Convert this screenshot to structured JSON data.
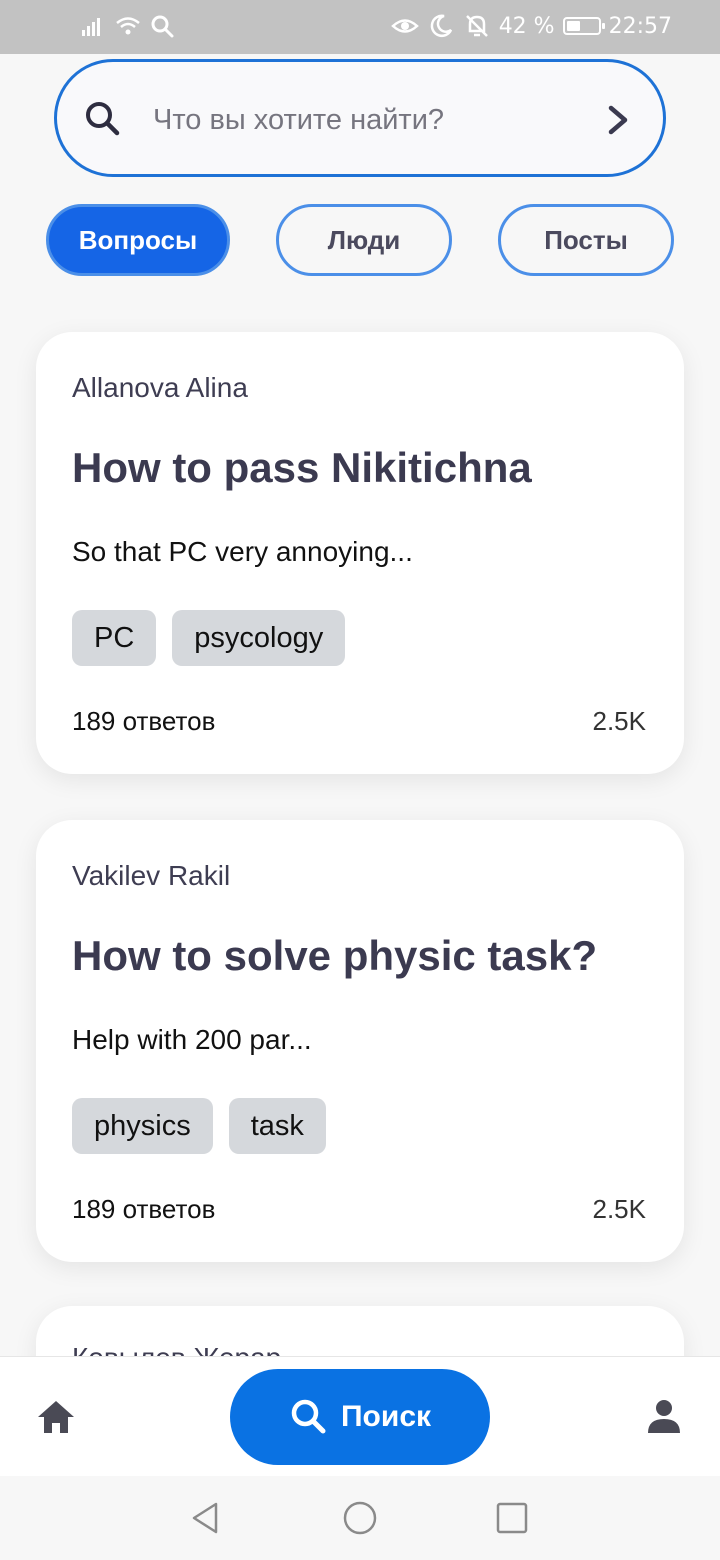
{
  "status_bar": {
    "battery_text": "42 %",
    "battery_level": 0.42,
    "time": "22:57",
    "icons_left": [
      "signal-icon",
      "wifi-icon",
      "search-icon"
    ],
    "icons_right": [
      "eye-icon",
      "moon-icon",
      "bell-off-icon",
      "battery-icon"
    ]
  },
  "search": {
    "placeholder": "Что вы хотите найти?",
    "value": ""
  },
  "filters": [
    {
      "label": "Вопросы",
      "active": true
    },
    {
      "label": "Люди",
      "active": false
    },
    {
      "label": "Посты",
      "active": false
    }
  ],
  "questions": [
    {
      "author": "Allanova Alina",
      "title": "How to pass Nikitichna",
      "snippet": "So that PC very annoying...",
      "tags": [
        "PC",
        "psycology"
      ],
      "answers": "189 ответов",
      "views": "2.5K"
    },
    {
      "author": "Vakilev Rakil",
      "title": "How to solve physic task?",
      "snippet": "Help with 200 par...",
      "tags": [
        "physics",
        "task"
      ],
      "answers": "189 ответов",
      "views": "2.5K"
    },
    {
      "author": "Ковылев Жерар"
    }
  ],
  "bottom_nav": {
    "search_label": "Поиск"
  },
  "colors": {
    "accent": "#1565e6",
    "search_border": "#1e72d6",
    "tag_bg": "#d5d8dc",
    "status_bar": "#c2c2c2"
  }
}
